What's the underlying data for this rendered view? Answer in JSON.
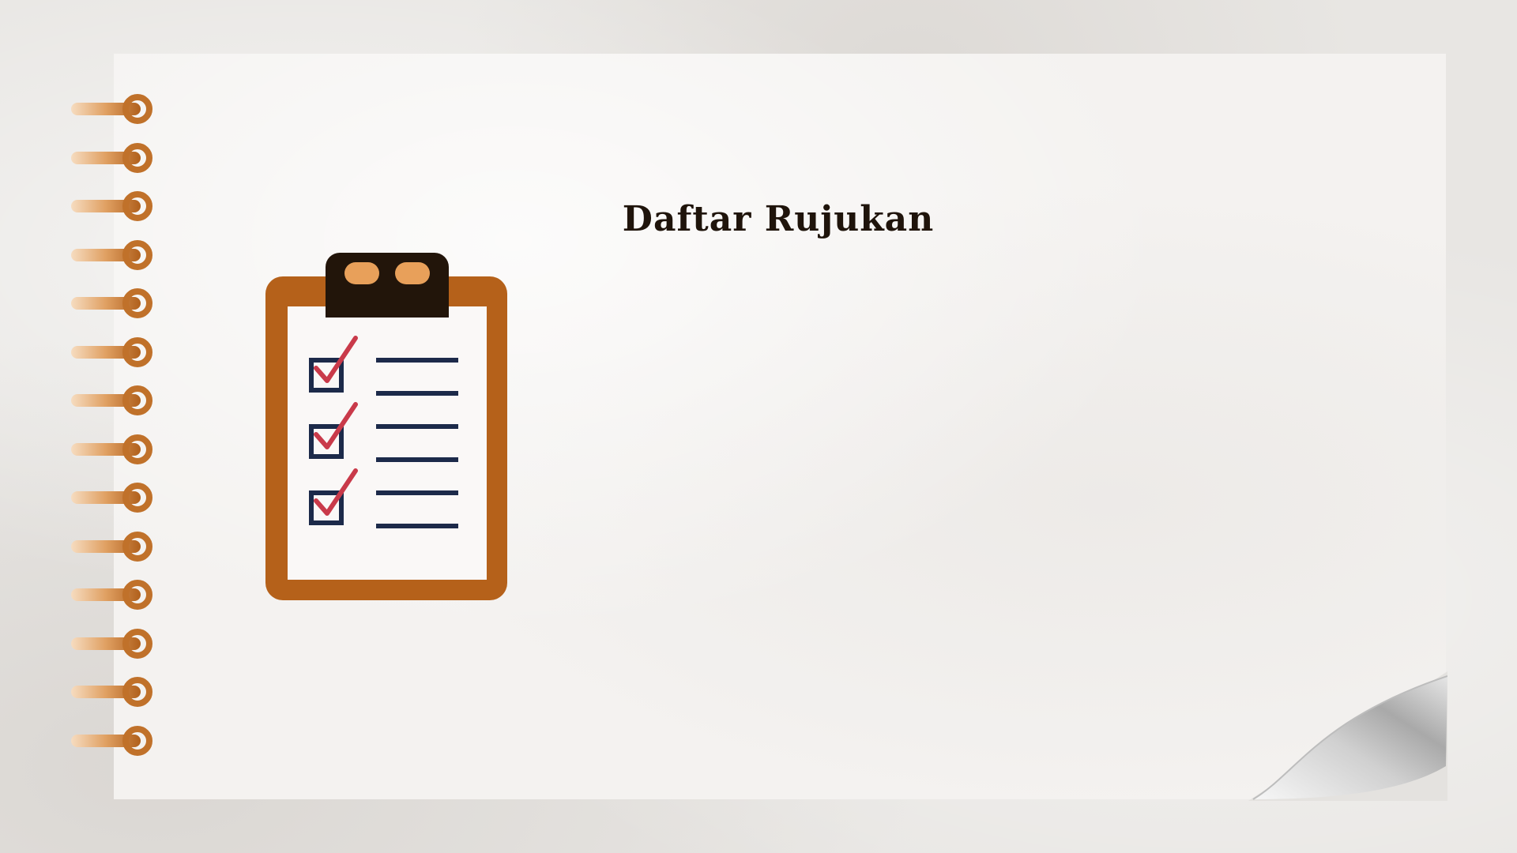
{
  "slide": {
    "title": "Daftar Rujukan"
  },
  "colors": {
    "background": "#e8e6e3",
    "paper": "#f4f2f0",
    "title_text": "#1f140b",
    "clipboard_frame": "#b5611a",
    "clipboard_clip": "#22150a",
    "clip_accent": "#e8a05a",
    "checkbox_border": "#1c2a4a",
    "checkmark": "#c93a4a",
    "list_line": "#1c2a4a",
    "spiral_ring": "#c87a30"
  },
  "icons": {
    "clipboard": "clipboard-checklist-icon",
    "page_curl": "page-curl-corner",
    "spiral_binding": "spiral-binding-rings"
  },
  "checklist": {
    "checked_items": 3,
    "total_items": 3
  }
}
